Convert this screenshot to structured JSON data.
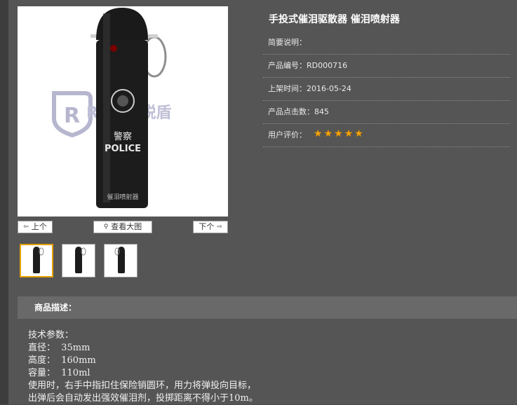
{
  "gallery": {
    "watermark_text": "R SON锐盾",
    "bottle_text_1": "警察",
    "bottle_text_2": "POLICE",
    "bottle_text_3": "催泪喷射器",
    "prev_label": "上个",
    "view_large_label": "查看大图",
    "next_label": "下个",
    "thumbnail_count": 3
  },
  "product": {
    "title": "手投式催泪驱散器 催泪喷射器",
    "summary_label": "简要说明：",
    "code_label": "产品编号：",
    "code_value": "RD000716",
    "date_label": "上架时间：",
    "date_value": "2016-05-24",
    "clicks_label": "产品点击数：",
    "clicks_value": "845",
    "rating_label": "用户评价：",
    "rating_value": 5,
    "star_color": "#f3a20a"
  },
  "description": {
    "header": "商品描述：",
    "lines": [
      "技术参数：",
      "直径：  35mm",
      "高度：  160mm",
      "容量：  110ml",
      "使用时，右手中指扣住保险销圆环，用力将弹投向目标，",
      "出弹后会自动发出强效催泪剂，投掷距离不得小于10m。"
    ]
  }
}
